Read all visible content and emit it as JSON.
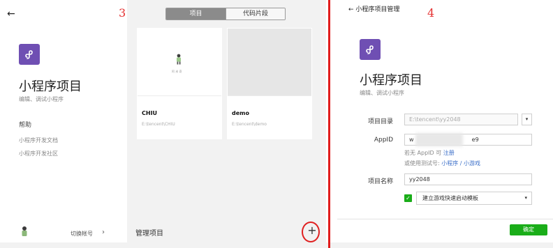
{
  "left_screen": {
    "back_icon": "back-arrow-icon",
    "logo_icon": "mini-program-logo-icon",
    "title": "小程序项目",
    "subtitle": "编辑、调试小程序",
    "help_title": "帮助",
    "help_links": [
      "小程序开发文档",
      "小程序开发社区"
    ],
    "switch_account": "切换帐号",
    "switch_chevron": "›",
    "step_number": "3",
    "tabs": [
      {
        "label": "项目",
        "active": true
      },
      {
        "label": "代码片段",
        "active": false
      }
    ],
    "projects": [
      {
        "name": "CHIU",
        "path": "E:\\tencent\\CHIU",
        "thumb_caption": "阿 米 奇"
      },
      {
        "name": "demo",
        "path": "E:\\tencent\\demo",
        "thumb_caption": ""
      }
    ],
    "manage_label": "管理项目",
    "add_icon": "plus-icon",
    "add_symbol": "+"
  },
  "right_screen": {
    "breadcrumb": "小程序项目管理",
    "back_symbol": "←",
    "step_number": "4",
    "logo_icon": "mini-program-logo-icon",
    "title": "小程序项目",
    "subtitle": "编辑、调试小程序",
    "form": {
      "directory_label": "项目目录",
      "directory_value": "E:\\tencent\\yy2048",
      "dropdown_symbol": "▾",
      "appid_label": "AppID",
      "appid_prefix": "w",
      "appid_suffix": "e9",
      "hint_line1_prefix": "若无 AppID 可",
      "hint_register": "注册",
      "hint_line2_prefix": "或使用测试号:",
      "hint_miniprogram": "小程序",
      "hint_separator": "/",
      "hint_minigame": "小游戏",
      "name_label": "项目名称",
      "name_value": "yy2048",
      "template_checked": true,
      "template_label": "建立游戏快速启动模板",
      "checkbox_symbol": "✓"
    },
    "confirm_label": "确定"
  },
  "colors": {
    "logo_purple": "#6f4fb3",
    "confirm_green": "#1aad19",
    "annotation_red": "#e11c1c",
    "link_blue": "#3a6ec8"
  }
}
